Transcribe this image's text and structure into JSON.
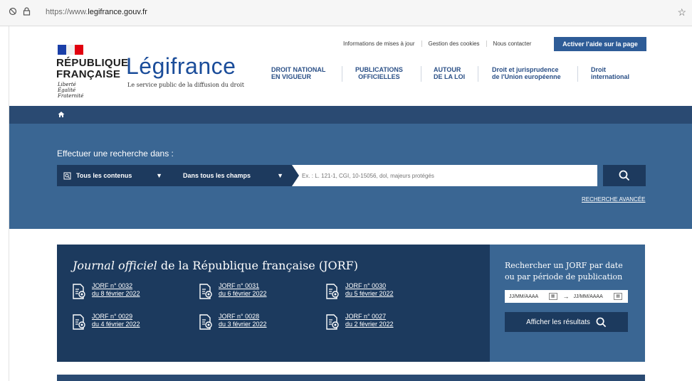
{
  "browser": {
    "url_prefix": "https://www.",
    "url_domain": "legifrance.gouv.fr",
    "star_icon": "star-icon"
  },
  "header": {
    "rf_title_line1": "RÉPUBLIQUE",
    "rf_title_line2": "FRANÇAISE",
    "motto_1": "Liberté",
    "motto_2": "Égalité",
    "motto_3": "Fraternité",
    "brand": "Légifrance",
    "brand_sub": "Le service public de la diffusion du droit",
    "toplinks": [
      "Informations de mises à jour",
      "Gestion des cookies",
      "Nous contacter"
    ],
    "help_button": "Activer l'aide sur la page",
    "nav": [
      {
        "l1": "DROIT NATIONAL",
        "l2": "EN VIGUEUR"
      },
      {
        "l1": "PUBLICATIONS",
        "l2": "OFFICIELLES"
      },
      {
        "l1": "AUTOUR",
        "l2": "DE LA LOI"
      },
      {
        "l1": "Droit et jurisprudence",
        "l2": "de l'Union européenne"
      },
      {
        "l1": "Droit",
        "l2": "international"
      }
    ],
    "colors": {
      "brand_blue": "#1b4d9a",
      "flag_blue": "#1a3fa8",
      "flag_red": "#e1000f"
    }
  },
  "search": {
    "label": "Effectuer une recherche dans :",
    "scope": "Tous les contenus",
    "field": "Dans tous les champs",
    "placeholder": "Ex. : L. 121-1, CGI, 10-15056, dol, majeurs protégés",
    "advanced": "RECHERCHE AVANCÉE"
  },
  "jorf": {
    "title_italic": "Journal officiel",
    "title_rest": " de la République française (JORF)",
    "items": [
      {
        "num": "JORF n° 0032",
        "date": "du 8 février 2022"
      },
      {
        "num": "JORF n° 0031",
        "date": "du 6 février 2022"
      },
      {
        "num": "JORF n° 0030",
        "date": "du 5 février 2022"
      },
      {
        "num": "JORF n° 0029",
        "date": "du 4 février 2022"
      },
      {
        "num": "JORF n° 0028",
        "date": "du 3 février 2022"
      },
      {
        "num": "JORF n° 0027",
        "date": "du 2 février 2022"
      }
    ],
    "search_title_1": "Rechercher un JORF par date",
    "search_title_2": "ou par période de publication",
    "date_from": "JJ/MM/AAAA",
    "date_to": "JJ/MM/AAAA",
    "show_button": "Afficher les résultats"
  }
}
